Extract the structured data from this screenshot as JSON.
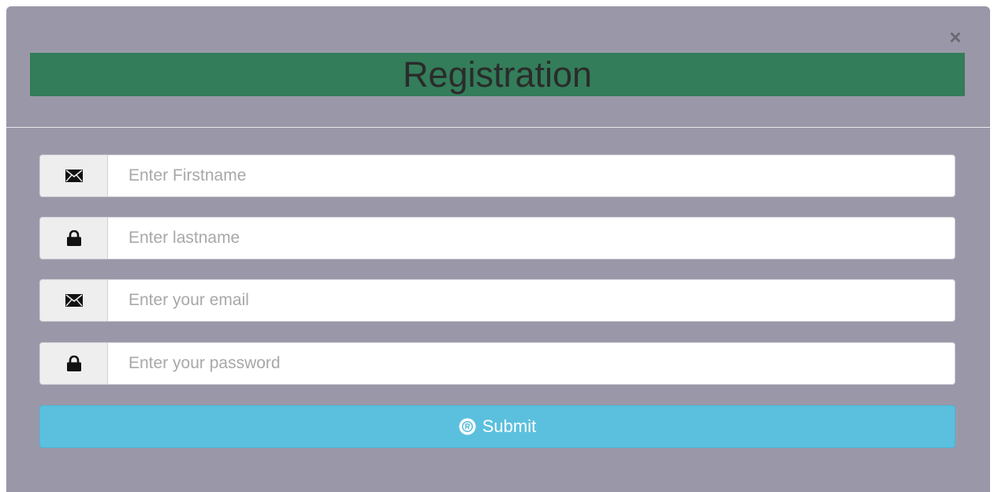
{
  "modal": {
    "title": "Registration",
    "close_glyph": "×",
    "fields": [
      {
        "icon": "envelope-icon",
        "placeholder": "Enter Firstname",
        "value": ""
      },
      {
        "icon": "lock-icon",
        "placeholder": "Enter lastname",
        "value": ""
      },
      {
        "icon": "envelope-icon",
        "placeholder": "Enter your email",
        "value": ""
      },
      {
        "icon": "lock-icon",
        "placeholder": "Enter your password",
        "value": ""
      }
    ],
    "submit_label": "Submit",
    "submit_icon": "registered-icon"
  },
  "colors": {
    "modal_bg": "#9a98a8",
    "title_bar": "#337d5a",
    "submit_bg": "#5bc0de"
  }
}
